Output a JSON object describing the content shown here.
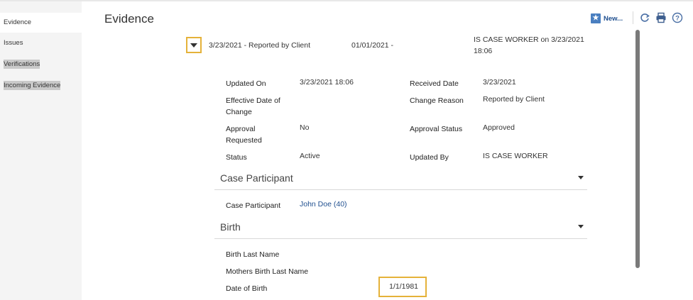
{
  "sidebar": {
    "items": [
      {
        "label": "Evidence"
      },
      {
        "label": "Issues"
      },
      {
        "label": "Verifications"
      },
      {
        "label": "Incoming Evidence"
      }
    ]
  },
  "header": {
    "title": "Evidence",
    "new_label": "New...",
    "icons": [
      "star-icon",
      "refresh-icon",
      "print-icon",
      "help-icon"
    ]
  },
  "evidence_row": {
    "summary": "3/23/2021 - Reported by Client",
    "period": "01/01/2021 -",
    "updated_line1": "IS CASE WORKER on 3/23/2021",
    "updated_line2": "18:06"
  },
  "details": {
    "updated_on_label": "Updated On",
    "updated_on_value": "3/23/2021 18:06",
    "received_date_label": "Received Date",
    "received_date_value": "3/23/2021",
    "effective_date_label_1": "Effective Date of",
    "effective_date_label_2": "Change",
    "change_reason_label": "Change Reason",
    "change_reason_value": "Reported by Client",
    "approval_requested_label_1": "Approval",
    "approval_requested_label_2": "Requested",
    "approval_requested_value": "No",
    "approval_status_label": "Approval Status",
    "approval_status_value": "Approved",
    "status_label": "Status",
    "status_value": "Active",
    "updated_by_label": "Updated By",
    "updated_by_value": "IS CASE WORKER"
  },
  "case_participant_section": {
    "title": "Case Participant",
    "participant_label": "Case Participant",
    "participant_value": "John Doe (40)"
  },
  "birth_section": {
    "title": "Birth",
    "birth_last_name_label": "Birth Last Name",
    "mothers_birth_last_name_label": "Mothers Birth Last Name",
    "date_of_birth_label": "Date of Birth",
    "date_of_birth_value": "1/1/1981"
  },
  "colors": {
    "highlight_border": "#e5b23a",
    "link": "#1f4f8f",
    "sidebar_bg": "#f4f4f4"
  }
}
